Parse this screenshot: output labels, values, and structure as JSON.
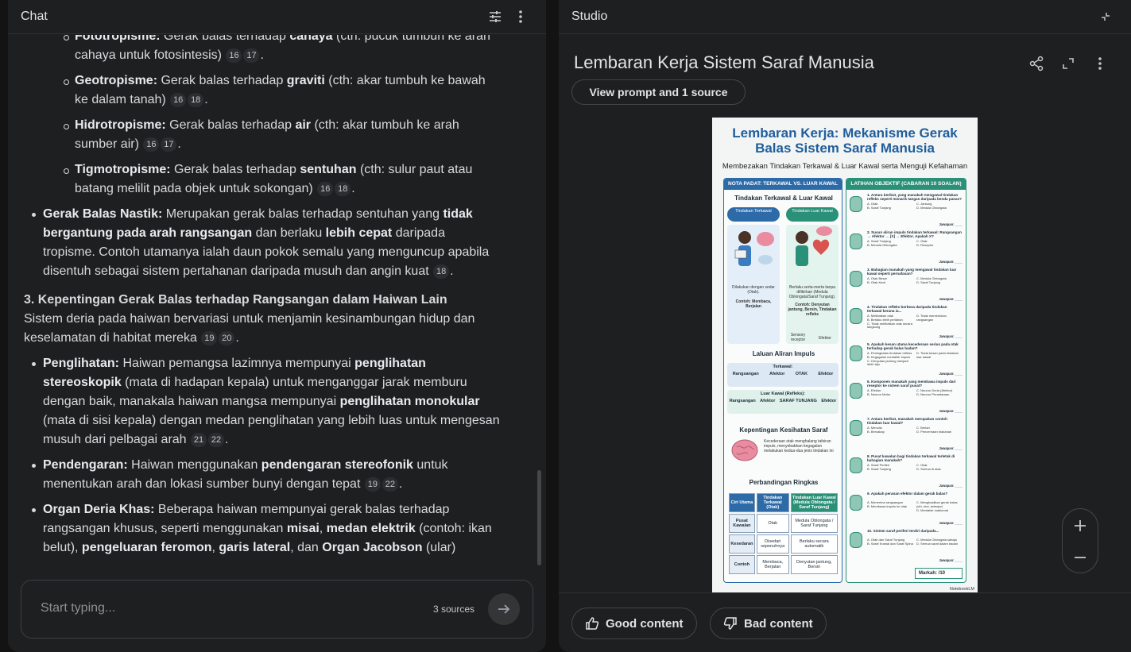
{
  "chat": {
    "title": "Chat",
    "sub_items": [
      {
        "term": "Fototropisme:",
        "pre": " Gerak balas terhadap ",
        "bold": "cahaya",
        "post": " (cth: pucuk tumbuh ke arah cahaya untuk fotosintesis)",
        "cites": [
          "16",
          "17"
        ]
      },
      {
        "term": "Geotropisme:",
        "pre": " Gerak balas terhadap ",
        "bold": "graviti",
        "post": " (cth: akar tumbuh ke bawah ke dalam tanah)",
        "cites": [
          "16",
          "18"
        ]
      },
      {
        "term": "Hidrotropisme:",
        "pre": " Gerak balas terhadap ",
        "bold": "air",
        "post": " (cth: akar tumbuh ke arah sumber air)",
        "cites": [
          "16",
          "17"
        ]
      },
      {
        "term": "Tigmotropisme:",
        "pre": " Gerak balas terhadap ",
        "bold": "sentuhan",
        "post": " (cth: sulur paut atau batang melilit pada objek untuk sokongan)",
        "cites": [
          "16",
          "18"
        ]
      }
    ],
    "nastik": {
      "term": "Gerak Balas Nastik:",
      "t1": " Merupakan gerak balas terhadap sentuhan yang ",
      "b1": "tidak bergantung pada arah rangsangan",
      "t2": " dan berlaku ",
      "b2": "lebih cepat",
      "t3": " daripada tropisme. Contoh utamanya ialah daun pokok semalu yang menguncup apabila disentuh sebagai sistem pertahanan daripada musuh dan angin kuat",
      "cites": [
        "18"
      ]
    },
    "section3": {
      "heading": "3. Kepentingan Gerak Balas terhadap Rangsangan dalam Haiwan Lain",
      "intro": "Sistem deria pada haiwan bervariasi untuk menjamin kesinambungan hidup dan keselamatan di habitat mereka",
      "cites": [
        "19",
        "20"
      ]
    },
    "penglihatan": {
      "term": "Penglihatan:",
      "t1": " Haiwan pemangsa lazimnya mempunyai ",
      "b1": "penglihatan stereoskopik",
      "t2": " (mata di hadapan kepala) untuk menganggar jarak memburu dengan baik, manakala haiwan mangsa mempunyai ",
      "b2": "penglihatan monokular",
      "t3": " (mata di sisi kepala) dengan medan penglihatan yang lebih luas untuk mengesan musuh dari pelbagai arah",
      "cites": [
        "21",
        "22"
      ]
    },
    "pendengaran": {
      "term": "Pendengaran:",
      "t1": " Haiwan menggunakan ",
      "b1": "pendengaran stereofonik",
      "t2": " untuk menentukan arah dan lokasi sumber bunyi dengan tepat",
      "cites": [
        "19",
        "22"
      ]
    },
    "organ": {
      "term": "Organ Deria Khas:",
      "t1": " Beberapa haiwan mempunyai gerak balas terhadap rangsangan khusus, seperti menggunakan ",
      "b1": "misai",
      "t2": ", ",
      "b2": "medan elektrik",
      "t3": " (contoh: ikan belut), ",
      "b3": "pengeluaran feromon",
      "t4": ", ",
      "b4": "garis lateral",
      "t5": ", dan ",
      "b5": "Organ Jacobson",
      "t6": " (ular)"
    },
    "input_placeholder": "Start typing...",
    "sources_count": "3 sources"
  },
  "studio": {
    "title": "Studio",
    "doc_title": "Lembaran Kerja Sistem Saraf Manusia",
    "prompt_button": "View prompt and 1 source",
    "good_label": "Good content",
    "bad_label": "Bad content"
  },
  "infographic": {
    "title_line1": "Lembaran Kerja: Mekanisme Gerak",
    "title_line2": "Balas Sistem Saraf Manusia",
    "subtitle": "Membezakan Tindakan Terkawal & Luar Kawal serta Menguji Kefahaman",
    "left_header": "NOTA PADAT: TERKAWAL VS. LUAR KAWAL",
    "right_header": "LATIHAN OBJEKTIF (CABARAN 10 SOALAN)",
    "section1": "Tindakan Terkawal & Luar Kawal",
    "tag_terkawal": "Tindakan Terkawal",
    "tag_luar": "Tindakan Luar Kawal",
    "terkawal_note": "Dilakukan dengan sedar (Otak).",
    "terkawal_example": "Contoh: Membaca, Berjalan",
    "luar_note": "Berlaku serta-merta tanpa difikirkan (Medula Oblongata/Saraf Tunjang).",
    "luar_example": "Contoh: Denyutan jantung, Bersin, Tindakan refleks",
    "label_sensory": "Sensory receptor",
    "label_effector": "Efektor",
    "section2": "Laluan Aliran Impuls",
    "flow1_title": "Terkawal:",
    "flow1_steps": [
      "Rangsangan",
      "Afektor",
      "OTAK",
      "Efektor"
    ],
    "flow2_title": "Luar Kawal (Refleks):",
    "flow2_steps": [
      "Rangsangan",
      "Afektor",
      "SARAF TUNJANG",
      "Efektor"
    ],
    "section3": "Kepentingan Kesihatan Saraf",
    "health_text": "Kecederaan otak menghalang tafsiran impuls, menyebabkan kegagalan melakukan kedua-dua jenis tindakan ini",
    "section4": "Perbandingan Ringkas",
    "table_headers": [
      "Ciri Utama",
      "Tindakan Terkawal (Otak)",
      "Tindakan Luar Kawal (Medula Oblongata / Saraf Tunjang)"
    ],
    "table_rows": [
      [
        "Pusat Kawalan",
        "Otak",
        "Medula Oblongata / Saraf Tunjang"
      ],
      [
        "Kesedaran",
        "Disedari sepenuhnya",
        "Berlaku secara automatik"
      ],
      [
        "Contoh",
        "Membaca, Berjalan",
        "Denyutan jantung, Bersin"
      ]
    ],
    "questions": [
      {
        "q": "1. Antara berikut, yang manakah mengawal tindakan refleks seperti menarik tangan daripada benda panas?",
        "opts": [
          "A. Otak",
          "B. Saraf Tunjang",
          "C. Jantung",
          "D. Medula Oblongata"
        ]
      },
      {
        "q": "2. Susun aliran impuls tindakan terkawal: Rangsangan → Afektor → [X] → Efektor. Apakah X?",
        "opts": [
          "A. Saraf Tunjang",
          "B. Medula Oblongata",
          "C. Otak",
          "D. Reseptor"
        ]
      },
      {
        "q": "3. Bahagian manakah yang mengawal tindakan luar kawal seperti pernafasan?",
        "opts": [
          "A. Otak Besar",
          "B. Otak Kecil",
          "C. Medula Oblongata",
          "D. Saraf Tunjang"
        ]
      },
      {
        "q": "4. Tindakan refleks berbeza daripada tindakan terkawal kerana ia...",
        "opts": [
          "A. Melibatkan otak",
          "B. Berlaku lebih perlahan",
          "C. Tidak melibatkan otak secara langsung",
          "D. Tidak memerlukan rangsangan"
        ]
      },
      {
        "q": "5. Apakah kesan utama kecederaan serius pada otak terhadap gerak balas badan?",
        "opts": [
          "A. Peningkatan tindakan refleks",
          "B. Kegagalan mentafsir impuls",
          "C. Denyutan jantung menjadi lebih laju",
          "D. Tiada kesan pada tindakan luar kawal"
        ]
      },
      {
        "q": "6. Komponen manakah yang membawa impuls dari reseptor ke sistem saraf pusat?",
        "opts": [
          "A. Efektor",
          "B. Neuron Motor",
          "C. Neuron Deria (Afektor)",
          "D. Neuron Perantaraan"
        ]
      },
      {
        "q": "7. Antara berikut, manakah merupakan contoh tindakan luar kawal?",
        "opts": [
          "A. Menulis",
          "B. Bercakap",
          "C. Berlari",
          "D. Pencernaan makanan"
        ]
      },
      {
        "q": "8. Pusat kawalan bagi tindakan terkawal terletak di bahagian manakah?",
        "opts": [
          "A. Saraf Periferi",
          "B. Saraf Tunjang",
          "C. Otak",
          "D. Semua di atas"
        ]
      },
      {
        "q": "9. Apakah peranan efektor dalam gerak balas?",
        "opts": [
          "A. Menerima rangsangan",
          "B. Membawa impuls ke otak",
          "C. Menghasilkan gerak balas (cth: otot, kelenjar)",
          "D. Mentafsir maklumat"
        ]
      },
      {
        "q": "10. Sistem saraf periferi terdiri daripada...",
        "opts": [
          "A. Otak dan Saraf Tunjang",
          "B. Saraf Kranial dan Saraf Spina",
          "C. Medula Oblongata sahaja",
          "D. Semua saraf dalam badan"
        ]
      }
    ],
    "answer_label": "Jawapan: ____",
    "markah": "Markah:    /10",
    "brand": "NotebookLM"
  }
}
